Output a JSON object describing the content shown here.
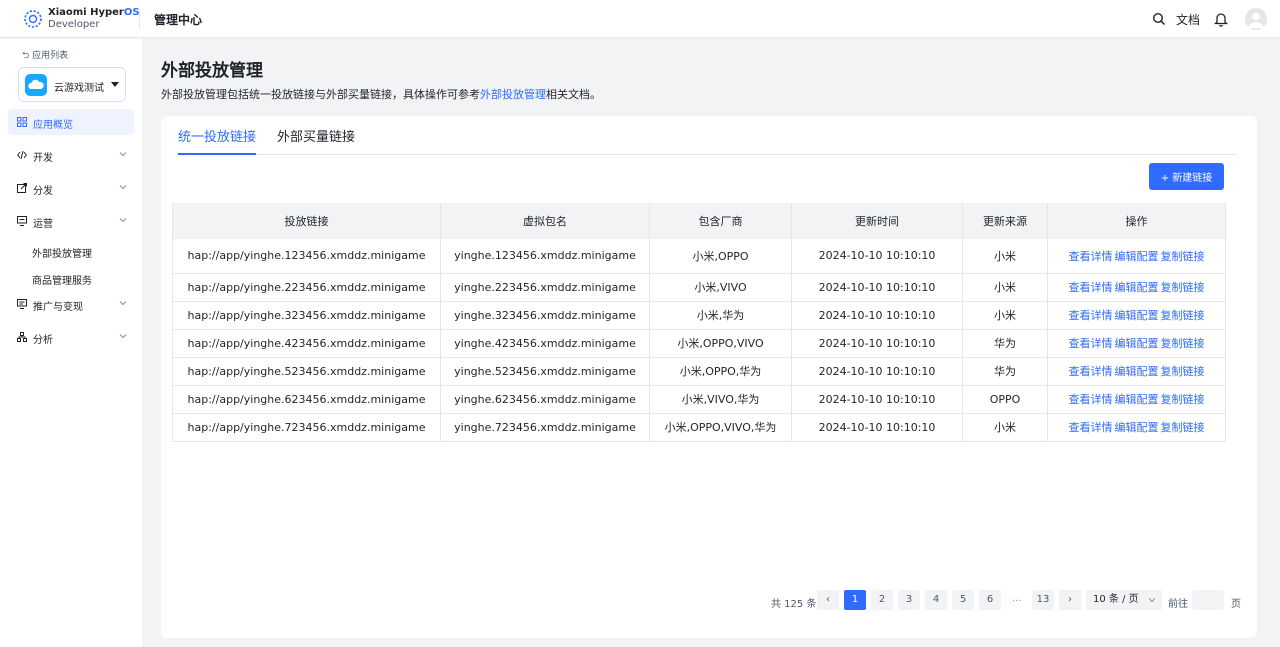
{
  "header": {
    "brand_line1": "Xiaomi Hyper",
    "brand_line1_os": "OS",
    "brand_line2": "Developer",
    "title": "管理中心",
    "doc_label": "文档",
    "icons": [
      "search-icon",
      "bell-icon",
      "avatar-icon"
    ]
  },
  "sidebar": {
    "back_label": "应用列表",
    "app_name": "云游戏测试",
    "items": [
      {
        "label": "应用概览",
        "icon": "grid-icon",
        "active": true
      },
      {
        "label": "开发",
        "icon": "code-icon"
      },
      {
        "label": "分发",
        "icon": "share-icon"
      },
      {
        "label": "运营",
        "icon": "monitor-icon"
      },
      {
        "label": "推广与变现",
        "icon": "promote-icon"
      },
      {
        "label": "分析",
        "icon": "analytics-icon"
      }
    ],
    "sub_items": [
      "外部投放管理",
      "商品管理服务"
    ]
  },
  "main": {
    "title": "外部投放管理",
    "desc_prefix": "外部投放管理包括统一投放链接与外部买量链接，具体操作可参考",
    "desc_link": "外部投放管理",
    "desc_suffix": "相关文档。",
    "tabs": [
      {
        "label": "统一投放链接",
        "active": true
      },
      {
        "label": "外部买量链接"
      }
    ],
    "new_button": "+ 新建链接"
  },
  "table": {
    "columns": [
      "投放链接",
      "虚拟包名",
      "包含厂商",
      "更新时间",
      "更新来源",
      "操作"
    ],
    "actions": [
      "查看详情",
      "编辑配置",
      "复制链接"
    ],
    "rows": [
      [
        "hap://app/yinghe.123456.xmddz.minigame",
        "yinghe.123456.xmddz.minigame",
        "小米,OPPO",
        "2024-10-10 10:10:10",
        "小米"
      ],
      [
        "hap://app/yinghe.223456.xmddz.minigame",
        "yinghe.223456.xmddz.minigame",
        "小米,VIVO",
        "2024-10-10 10:10:10",
        "小米"
      ],
      [
        "hap://app/yinghe.323456.xmddz.minigame",
        "yinghe.323456.xmddz.minigame",
        "小米,华为",
        "2024-10-10 10:10:10",
        "小米"
      ],
      [
        "hap://app/yinghe.423456.xmddz.minigame",
        "yinghe.423456.xmddz.minigame",
        "小米,OPPO,VIVO",
        "2024-10-10 10:10:10",
        "华为"
      ],
      [
        "hap://app/yinghe.523456.xmddz.minigame",
        "yinghe.523456.xmddz.minigame",
        "小米,OPPO,华为",
        "2024-10-10 10:10:10",
        "华为"
      ],
      [
        "hap://app/yinghe.623456.xmddz.minigame",
        "yinghe.623456.xmddz.minigame",
        "小米,VIVO,华为",
        "2024-10-10 10:10:10",
        "OPPO"
      ],
      [
        "hap://app/yinghe.723456.xmddz.minigame",
        "yinghe.723456.xmddz.minigame",
        "小米,OPPO,VIVO,华为",
        "2024-10-10 10:10:10",
        "小米"
      ]
    ]
  },
  "pagination": {
    "total_label": "共 125 条",
    "pages": [
      "1",
      "2",
      "3",
      "4",
      "5",
      "6"
    ],
    "ellipsis": "...",
    "last_page": "13",
    "current": "1",
    "page_size": "10 条 / 页",
    "goto_label": "前往",
    "page_label": "页"
  },
  "colors": {
    "accent": "#2f6bff",
    "background": "#f2f3f5"
  }
}
